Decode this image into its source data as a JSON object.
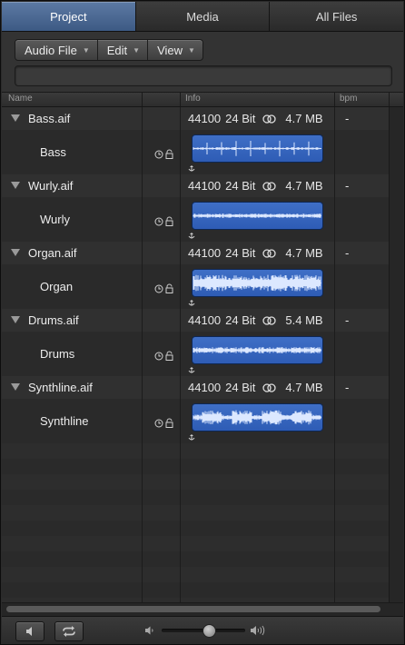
{
  "tabs": [
    {
      "label": "Project",
      "active": true
    },
    {
      "label": "Media",
      "active": false
    },
    {
      "label": "All Files",
      "active": false
    }
  ],
  "toolbar": {
    "menus": [
      "Audio File",
      "Edit",
      "View"
    ],
    "search_value": ""
  },
  "columns": {
    "name": "Name",
    "info": "Info",
    "bpm": "bpm"
  },
  "files": [
    {
      "name": "Bass.aif",
      "rate": "44100",
      "bits": "24 Bit",
      "size": "4.7 MB",
      "bpm": "-",
      "region": "Bass",
      "waveform": "sparse"
    },
    {
      "name": "Wurly.aif",
      "rate": "44100",
      "bits": "24 Bit",
      "size": "4.7 MB",
      "bpm": "-",
      "region": "Wurly",
      "waveform": "thin"
    },
    {
      "name": "Organ.aif",
      "rate": "44100",
      "bits": "24 Bit",
      "size": "4.7 MB",
      "bpm": "-",
      "region": "Organ",
      "waveform": "dense"
    },
    {
      "name": "Drums.aif",
      "rate": "44100",
      "bits": "24 Bit",
      "size": "5.4 MB",
      "bpm": "-",
      "region": "Drums",
      "waveform": "thin-medium"
    },
    {
      "name": "Synthline.aif",
      "rate": "44100",
      "bits": "24 Bit",
      "size": "4.7 MB",
      "bpm": "-",
      "region": "Synthline",
      "waveform": "dense-bursts"
    }
  ],
  "volume": 0.55,
  "colors": {
    "accent": "#3d5a84",
    "region": "#3468c2",
    "waveform": "#dce8ff"
  }
}
